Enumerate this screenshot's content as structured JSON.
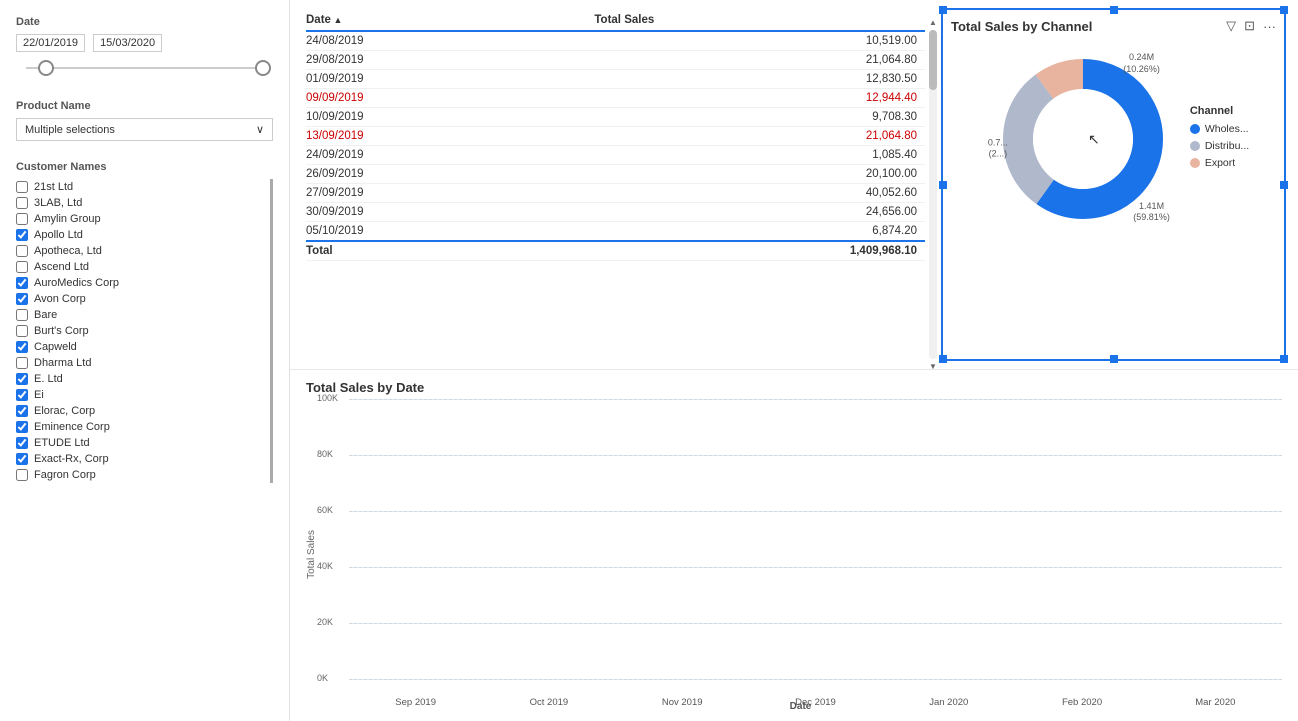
{
  "left_panel": {
    "date_label": "Date",
    "date_start": "22/01/2019",
    "date_end": "15/03/2020",
    "product_label": "Product Name",
    "product_placeholder": "Multiple selections",
    "customer_label": "Customer Names",
    "customers": [
      {
        "name": "21st Ltd",
        "checked": false
      },
      {
        "name": "3LAB, Ltd",
        "checked": false
      },
      {
        "name": "Amylin Group",
        "checked": false
      },
      {
        "name": "Apollo Ltd",
        "checked": true
      },
      {
        "name": "Apotheca, Ltd",
        "checked": false
      },
      {
        "name": "Ascend Ltd",
        "checked": false
      },
      {
        "name": "AuroMedics Corp",
        "checked": true
      },
      {
        "name": "Avon Corp",
        "checked": true
      },
      {
        "name": "Bare",
        "checked": false
      },
      {
        "name": "Burt's Corp",
        "checked": false
      },
      {
        "name": "Capweld",
        "checked": true
      },
      {
        "name": "Dharma Ltd",
        "checked": false
      },
      {
        "name": "E. Ltd",
        "checked": true
      },
      {
        "name": "Ei",
        "checked": true
      },
      {
        "name": "Elorac, Corp",
        "checked": true
      },
      {
        "name": "Eminence Corp",
        "checked": true
      },
      {
        "name": "ETUDE Ltd",
        "checked": true
      },
      {
        "name": "Exact-Rx, Corp",
        "checked": true
      },
      {
        "name": "Fagron Corp",
        "checked": false
      }
    ]
  },
  "table": {
    "col_date": "Date",
    "col_sales": "Total Sales",
    "rows": [
      {
        "date": "24/08/2019",
        "sales": "10,519.00",
        "highlight": false
      },
      {
        "date": "29/08/2019",
        "sales": "21,064.80",
        "highlight": false
      },
      {
        "date": "01/09/2019",
        "sales": "12,830.50",
        "highlight": false
      },
      {
        "date": "09/09/2019",
        "sales": "12,944.40",
        "highlight": true
      },
      {
        "date": "10/09/2019",
        "sales": "9,708.30",
        "highlight": false
      },
      {
        "date": "13/09/2019",
        "sales": "21,064.80",
        "highlight": true
      },
      {
        "date": "24/09/2019",
        "sales": "1,085.40",
        "highlight": false
      },
      {
        "date": "26/09/2019",
        "sales": "20,100.00",
        "highlight": false
      },
      {
        "date": "27/09/2019",
        "sales": "40,052.60",
        "highlight": false
      },
      {
        "date": "30/09/2019",
        "sales": "24,656.00",
        "highlight": false
      },
      {
        "date": "05/10/2019",
        "sales": "6,874.20",
        "highlight": false
      }
    ],
    "total_label": "Total",
    "total_value": "1,409,968.10"
  },
  "donut": {
    "title": "Total Sales by Channel",
    "filter_icon": "▽",
    "expand_icon": "⊡",
    "more_icon": "···",
    "segments": [
      {
        "label": "Wholes...",
        "color": "#1a73e8",
        "pct": 59.81,
        "value": "1.41M",
        "deg_start": -90,
        "deg_end": 125
      },
      {
        "label": "Distribu...",
        "color": "#b0b8cc",
        "pct": 29.93,
        "value": "0.7...",
        "deg_start": 125,
        "deg_end": 215
      },
      {
        "label": "Export",
        "color": "#e8b4a0",
        "pct": 10.26,
        "value": "0.24M",
        "deg_start": 215,
        "deg_end": 270
      }
    ],
    "legend_title": "Channel",
    "label_top": "0.24M\n(10.26%)",
    "label_left": "0.7...\n(2...)",
    "label_bottom_right": "1.41M\n(59.81%)"
  },
  "bar_chart": {
    "title": "Total Sales by Date",
    "y_label": "Total Sales",
    "x_label": "Date",
    "y_ticks": [
      "100K",
      "80K",
      "60K",
      "40K",
      "20K",
      "0K"
    ],
    "x_labels": [
      "Sep 2019",
      "Oct 2019",
      "Nov 2019",
      "Dec 2019",
      "Jan 2020",
      "Feb 2020",
      "Mar 2020"
    ],
    "colors": {
      "dark_blue": "#1a73e8",
      "light_blue": "#a8c8f0"
    }
  }
}
